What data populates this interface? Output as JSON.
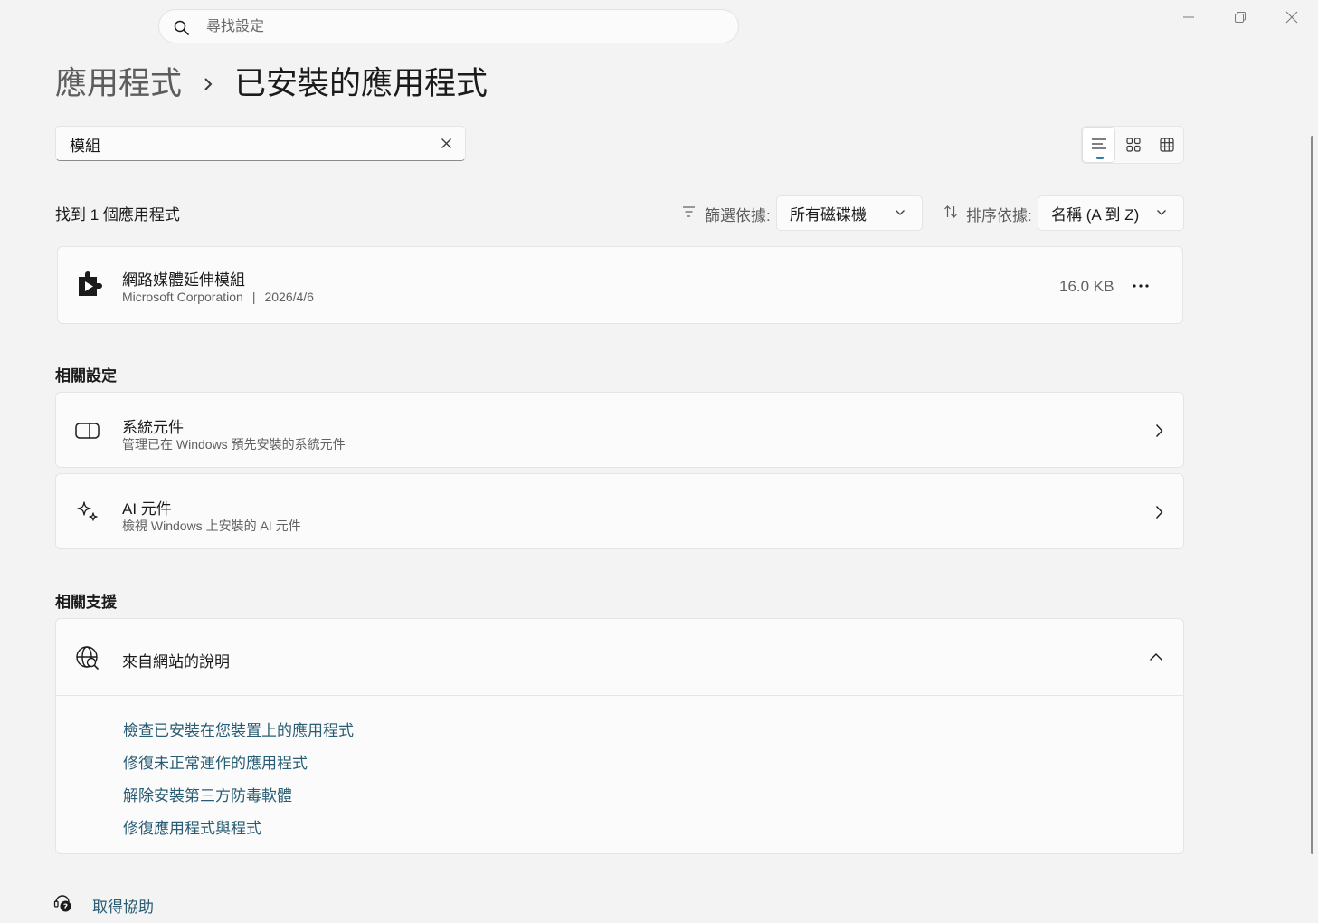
{
  "search": {
    "placeholder": "尋找設定"
  },
  "breadcrumb": {
    "parent": "應用程式",
    "current": "已安裝的應用程式"
  },
  "filter_input": {
    "value": "模組"
  },
  "results": {
    "count_text": "找到 1 個應用程式",
    "filter_label": "篩選依據:",
    "filter_value": "所有磁碟機",
    "sort_label": "排序依據:",
    "sort_value": "名稱 (A 到 Z)"
  },
  "apps": [
    {
      "name": "網路媒體延伸模組",
      "publisher": "Microsoft Corporation",
      "separator": "|",
      "date": "2026/4/6",
      "size": "16.0 KB",
      "icon": "media-extension-icon"
    }
  ],
  "related_settings": {
    "heading": "相關設定",
    "items": [
      {
        "title": "系統元件",
        "desc": "管理已在 Windows 預先安裝的系統元件",
        "icon": "system-components-icon"
      },
      {
        "title": "AI 元件",
        "desc": "檢視 Windows 上安裝的 AI 元件",
        "icon": "sparkle-icon"
      }
    ]
  },
  "related_support": {
    "heading": "相關支援",
    "expander_title": "來自網站的說明",
    "links": [
      "檢查已安裝在您裝置上的應用程式",
      "修復未正常運作的應用程式",
      "解除安裝第三方防毒軟體",
      "修復應用程式與程式"
    ]
  },
  "help": {
    "label": "取得協助"
  },
  "colors": {
    "accent": "#2f7fa0",
    "link": "#2a5d74",
    "background": "#f3f3f3",
    "card": "#fbfbfb"
  }
}
